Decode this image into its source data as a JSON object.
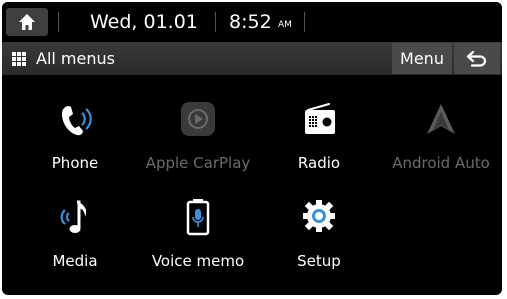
{
  "status": {
    "date": "Wed, 01.01",
    "time": "8:52",
    "ampm": "AM"
  },
  "header": {
    "title": "All menus",
    "menu_label": "Menu"
  },
  "apps": [
    {
      "label": "Phone",
      "icon": "phone-icon",
      "enabled": true
    },
    {
      "label": "Apple CarPlay",
      "icon": "apple-carplay-icon",
      "enabled": false
    },
    {
      "label": "Radio",
      "icon": "radio-icon",
      "enabled": true
    },
    {
      "label": "Android Auto",
      "icon": "android-auto-icon",
      "enabled": false
    },
    {
      "label": "Media",
      "icon": "music-note-icon",
      "enabled": true
    },
    {
      "label": "Voice memo",
      "icon": "microphone-icon",
      "enabled": true
    },
    {
      "label": "Setup",
      "icon": "gear-icon",
      "enabled": true
    }
  ],
  "colors": {
    "background": "#000000",
    "accent_blue": "#3a8fd9",
    "disabled_gray": "#6a6a6a"
  }
}
